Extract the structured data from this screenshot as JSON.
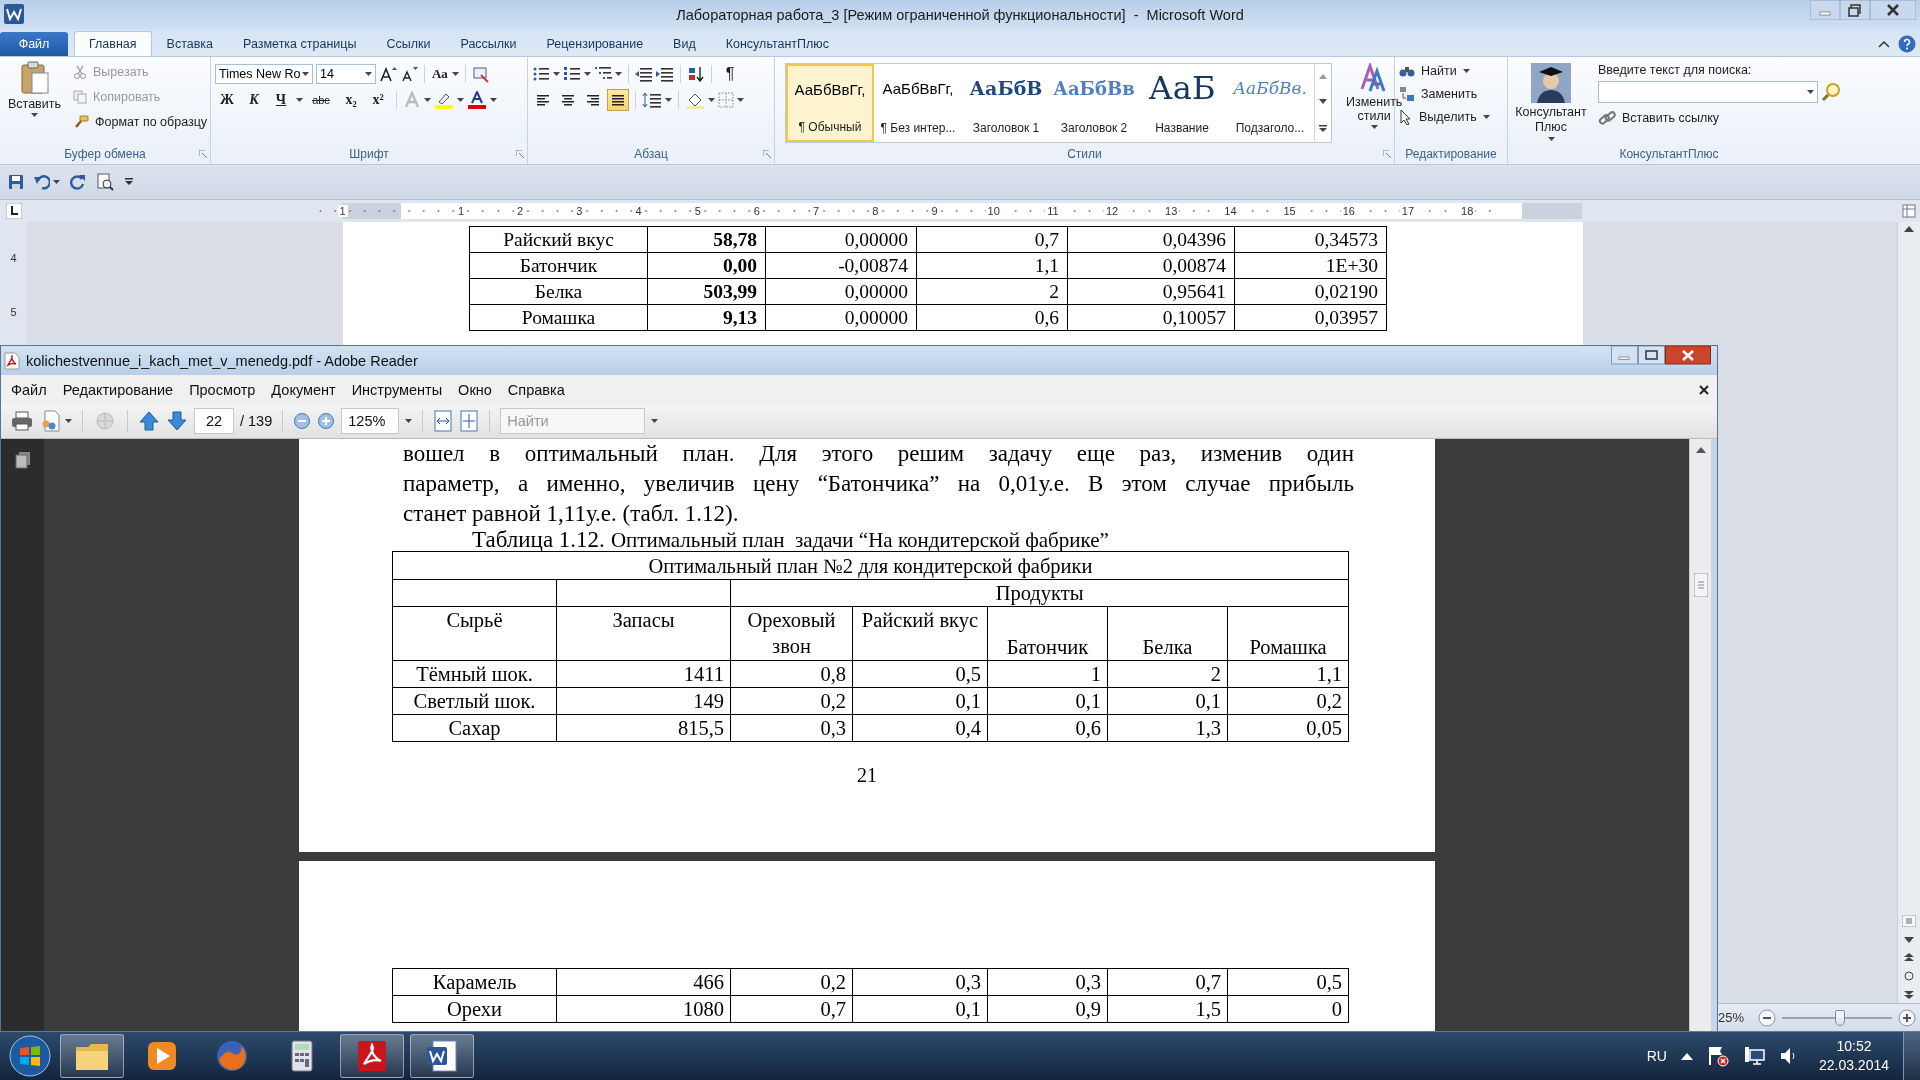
{
  "word": {
    "title": "Лабораторная работа_3 [Режим ограниченной функциональности]  -  Microsoft Word",
    "file_tab": "Файл",
    "tabs": [
      {
        "label": "Главная",
        "selected": true
      },
      {
        "label": "Вставка",
        "selected": false
      },
      {
        "label": "Разметка страницы",
        "selected": false
      },
      {
        "label": "Ссылки",
        "selected": false
      },
      {
        "label": "Рассылки",
        "selected": false
      },
      {
        "label": "Рецензирование",
        "selected": false
      },
      {
        "label": "Вид",
        "selected": false
      },
      {
        "label": "КонсультантПлюс",
        "selected": false
      }
    ],
    "clipboard": {
      "paste": "Вставить",
      "cut": {
        "label": "Вырезать",
        "disabled": true
      },
      "copy": {
        "label": "Копировать",
        "disabled": true
      },
      "format_painter": {
        "label": "Формат по образцу",
        "disabled": false
      },
      "group": "Буфер обмена"
    },
    "font": {
      "name": "Times New Ro",
      "size": "14",
      "change_case": "Аа",
      "bold": "Ж",
      "italic": "К",
      "underline": "Ч",
      "strike": "abc",
      "subscript": "x₂",
      "superscript": "x²",
      "group": "Шрифт"
    },
    "paragraph": {
      "show_marks": "¶",
      "align_buttons": [
        {
          "selected": false
        },
        {
          "selected": false
        },
        {
          "selected": false
        },
        {
          "selected": true
        }
      ],
      "group": "Абзац"
    },
    "styles": {
      "items": [
        {
          "kind": "normal",
          "sample": "АаБбВвГг,",
          "label": "¶ Обычный",
          "selected": true
        },
        {
          "kind": "normal",
          "sample": "АаБбВвГг,",
          "label": "¶ Без интер...",
          "selected": false
        },
        {
          "kind": "heading1",
          "sample": "АаБбВ",
          "label": "Заголовок 1",
          "selected": false
        },
        {
          "kind": "heading2",
          "sample": "АаБбВв",
          "label": "Заголовок 2",
          "selected": false
        },
        {
          "kind": "title",
          "sample": "АаБ",
          "label": "Название",
          "selected": false
        },
        {
          "kind": "subtitle",
          "sample": "АаБбВв.",
          "label": "Подзаголо...",
          "selected": false
        }
      ],
      "change_styles": "Изменить стили",
      "group": "Стили"
    },
    "editing": {
      "find": "Найти",
      "replace": "Заменить",
      "select": "Выделить",
      "group": "Редактирование"
    },
    "consultant": {
      "button": "Консультант Плюс",
      "search_label": "Введите текст для поиска:",
      "insert_link": "Вставить ссылку",
      "group": "КонсультантПлюс"
    },
    "ruler": [
      "1",
      "1",
      "2",
      "3",
      "4",
      "5",
      "6",
      "7",
      "8",
      "9",
      "10",
      "11",
      "12",
      "13",
      "14",
      "15",
      "16",
      "17",
      "18"
    ],
    "vertical_ruler": [
      "4",
      "5"
    ],
    "table": {
      "rows": [
        [
          "Райский вкус",
          "58,78",
          "0,00000",
          "0,7",
          "0,04396",
          "0,34573"
        ],
        [
          "Батончик",
          "0,00",
          "-0,00874",
          "1,1",
          "0,00874",
          "1E+30"
        ],
        [
          "Белка",
          "503,99",
          "0,00000",
          "2",
          "0,95641",
          "0,02190"
        ],
        [
          "Ромашка",
          "9,13",
          "0,00000",
          "0,6",
          "0,10057",
          "0,03957"
        ]
      ]
    },
    "zoom": "25%",
    "zoom_slider": {
      "level": 0.53
    }
  },
  "reader": {
    "title": "kolichestvennue_i_kach_met_v_menedg.pdf - Adobe Reader",
    "menu": [
      "Файл",
      "Редактирование",
      "Просмотр",
      "Документ",
      "Инструменты",
      "Окно",
      "Справка"
    ],
    "page": "22",
    "page_total": "/ 139",
    "zoom": "125%",
    "search": {
      "placeholder": "Найти"
    },
    "text_lines": [
      "вошел в оптимальный план. Для этого решим задачу еще раз, изменив один",
      "параметр, а именно, увеличив цену “Батончика” на 0,01у.е. В этом случае прибыль",
      "станет равной 1,11у.е. (табл. 1.12)."
    ],
    "caption": {
      "label": "Таблица 1.12.",
      "text": "Оптимальный план  задачи “На кондитерской фабрике”"
    },
    "table": {
      "title": "Оптимальный план №2 для кондитерской фабрики",
      "group_header": "Продукты",
      "columns": [
        "Сырьё",
        "Запасы",
        "Ореховый звон",
        "Райский вкус",
        "Батончик",
        "Белка",
        "Ромашка"
      ],
      "rows": [
        [
          "Тёмный шок.",
          "1411",
          "0,8",
          "0,5",
          "1",
          "2",
          "1,1"
        ],
        [
          "Светлый шок.",
          "149",
          "0,2",
          "0,1",
          "0,1",
          "0,1",
          "0,2"
        ],
        [
          "Сахар",
          "815,5",
          "0,3",
          "0,4",
          "0,6",
          "1,3",
          "0,05"
        ]
      ]
    },
    "page_number": "21",
    "next_page_rows": [
      [
        "Карамель",
        "466",
        "0,2",
        "0,3",
        "0,3",
        "0,7",
        "0,5"
      ],
      [
        "Орехи",
        "1080",
        "0,7",
        "0,1",
        "0,9",
        "1,5",
        "0"
      ]
    ]
  },
  "taskbar": {
    "apps": [
      {
        "kind": "explorer",
        "running": true
      },
      {
        "kind": "media",
        "running": false
      },
      {
        "kind": "firefox",
        "running": false
      },
      {
        "kind": "calculator",
        "running": false
      },
      {
        "kind": "acrobat",
        "running": true
      },
      {
        "kind": "word",
        "running": true
      }
    ],
    "language": "RU",
    "time": "10:52",
    "date": "22.03.2014"
  }
}
